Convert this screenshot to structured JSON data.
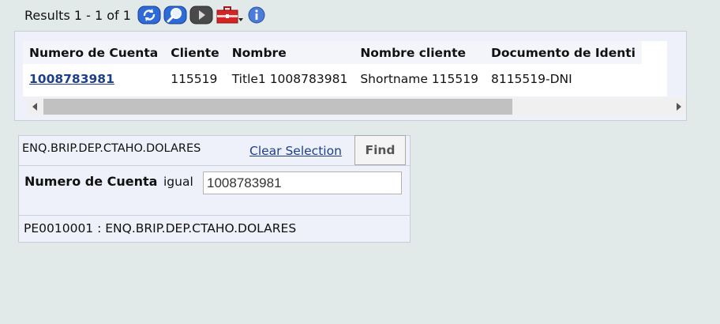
{
  "results": {
    "summary": "Results 1 - 1 of 1",
    "toolbar": [
      {
        "name": "refresh-icon",
        "color": "#2f6bd8"
      },
      {
        "name": "zoom-search-icon",
        "color": "#2f6bd8"
      },
      {
        "name": "play-next-icon",
        "color": "#444444"
      },
      {
        "name": "toolbox-dropdown-icon",
        "color": "#cc2020"
      },
      {
        "name": "info-icon",
        "color": "#4a7cd8"
      }
    ]
  },
  "table": {
    "columns": [
      "Numero de Cuenta",
      "Cliente",
      "Nombre",
      "Nombre cliente",
      "Documento de Identi"
    ],
    "rows": [
      [
        "1008783981",
        "115519",
        "Title1 1008783981",
        "Shortname 115519",
        "8115519-DNI"
      ]
    ]
  },
  "selection": {
    "title": "ENQ.BRIP.DEP.CTAHO.DOLARES",
    "clear_label": "Clear Selection",
    "find_label": "Find",
    "criteria": {
      "field_label": "Numero de Cuenta",
      "operator": "igual",
      "value": "1008783981"
    },
    "footer": "PE0010001 : ENQ.BRIP.DEP.CTAHO.DOLARES"
  }
}
